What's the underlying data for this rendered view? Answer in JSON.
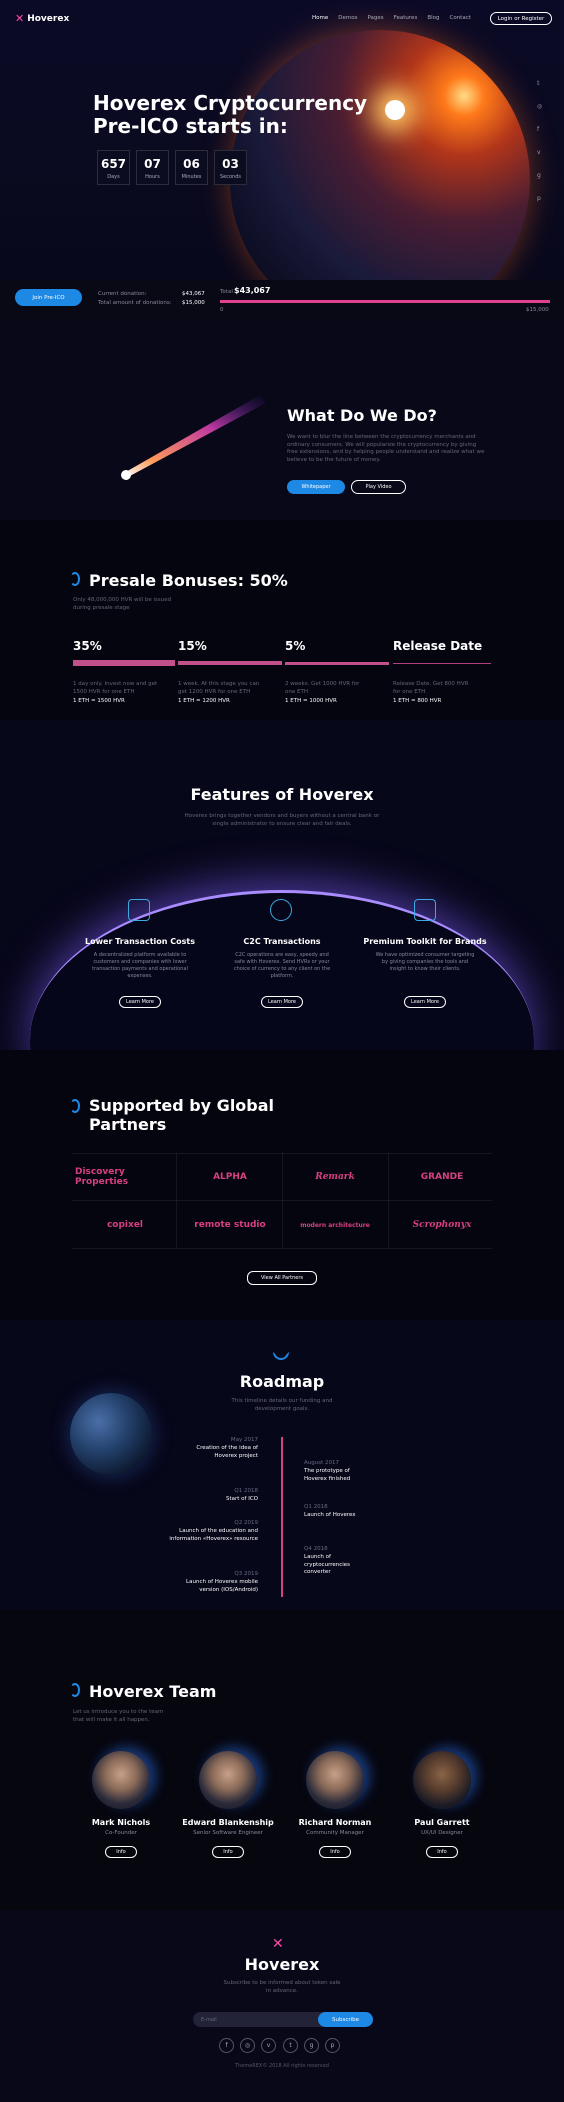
{
  "header": {
    "logo": "Hoverex",
    "nav": [
      "Home",
      "Demos",
      "Pages",
      "Features",
      "Blog",
      "Contact"
    ],
    "login": "Login or Register"
  },
  "hero": {
    "title": "Hoverex Cryptocurrency Pre-ICO starts in:",
    "countdown": [
      {
        "value": "657",
        "label": "Days"
      },
      {
        "value": "07",
        "label": "Hours"
      },
      {
        "value": "06",
        "label": "Minutes"
      },
      {
        "value": "03",
        "label": "Seconds"
      }
    ],
    "social_icons": [
      "twitter-icon",
      "instagram-icon",
      "facebook-icon",
      "vk-icon",
      "google-plus-icon",
      "pinterest-icon"
    ]
  },
  "ico": {
    "join": "Join Pre-ICO",
    "current_label": "Current donation:",
    "current_value": "$43,067",
    "total_label": "Total amount of donations:",
    "total_value": "$15,000",
    "raised_prefix": "Total",
    "raised": "$43,067",
    "bar_min": "0",
    "bar_max": "$15,000",
    "progress": 1.0
  },
  "what": {
    "title": "What Do We Do?",
    "text": "We want to blur the line between the cryptocurrency merchants and ordinary consumers. We will popularize the cryptocurrency by giving free extensions, and by helping people understand and realize what we believe to be the future of money.",
    "btn1": "Whitepaper",
    "btn2": "Play Video"
  },
  "presale": {
    "title": "Presale Bonuses: 50%",
    "subtitle": "Only 48,000,000 HVR will be issued during presale stage",
    "stages": [
      {
        "pct": "35%",
        "desc": "1 day only. Invest now and get 1500 HVR for one ETH",
        "rate": "1 ETH = 1500 HVR"
      },
      {
        "pct": "15%",
        "desc": "1 week. At this stage you can get 1200 HVR for one ETH",
        "rate": "1 ETH = 1200 HVR"
      },
      {
        "pct": "5%",
        "desc": "2 weeks. Get 1000 HVR for one ETH",
        "rate": "1 ETH = 1000 HVR"
      },
      {
        "pct": "Release Date",
        "desc": "Release Date. Get 800 HVR for one ETH",
        "rate": "1 ETH = 800 HVR"
      }
    ]
  },
  "features": {
    "title": "Features of Hoverex",
    "subtitle": "Hoverex brings together vendors and buyers without a central bank or single administrator to ensure clear and fair deals.",
    "items": [
      {
        "title": "Lower Transaction Costs",
        "text": "A decentralized platform available to customers and companies with lower transaction payments and operational expenses.",
        "btn": "Learn More"
      },
      {
        "title": "C2C Transactions",
        "text": "C2C operations are easy, speedy and safe with Hoverex. Send HVRs or your choice of currency to any client on the platform.",
        "btn": "Learn More"
      },
      {
        "title": "Premium Toolkit for Brands",
        "text": "We have optimized consumer targeting by giving companies the tools and insight to know their clients.",
        "btn": "Learn More"
      }
    ]
  },
  "partners": {
    "title": "Supported by Global Partners",
    "logos": [
      "Discovery Properties",
      "ALPHA",
      "Remark",
      "GRANDE",
      "copixel",
      "remote studio",
      "modern architecture",
      "Scrophonyx"
    ],
    "btn": "View All Partners"
  },
  "roadmap": {
    "title": "Roadmap",
    "subtitle": "This timeline details our funding and development goals.",
    "left": [
      {
        "date": "May 2017",
        "text": "Creation of the idea of Hoverex project"
      },
      {
        "date": "Q1 2018",
        "text": "Start of ICO"
      },
      {
        "date": "Q2 2019",
        "text": "Launch of the education and information «Hoverex» resource"
      },
      {
        "date": "Q3 2019",
        "text": "Launch of Hoverex mobile version (IOS/Android)"
      }
    ],
    "right": [
      {
        "date": "August 2017",
        "text": "The prototype of Hoverex finished"
      },
      {
        "date": "Q1 2018",
        "text": "Launch of Hoverex"
      },
      {
        "date": "Q4 2018",
        "text": "Launch of cryptocurrencies converter"
      }
    ]
  },
  "team": {
    "title": "Hoverex Team",
    "subtitle": "Let us introduce you to the team that will make it all happen.",
    "members": [
      {
        "name": "Mark Nichols",
        "role": "Co-Founder",
        "btn": "Info"
      },
      {
        "name": "Edward Blankenship",
        "role": "Senior Software Engineer",
        "btn": "Info"
      },
      {
        "name": "Richard Norman",
        "role": "Community Manager",
        "btn": "Info"
      },
      {
        "name": "Paul Garrett",
        "role": "UX/UI Designer",
        "btn": "Info"
      }
    ]
  },
  "footer": {
    "logo": "Hoverex",
    "subtitle": "Subscribe to be informed about token sale in advance.",
    "email_placeholder": "E-mail",
    "subscribe": "Subscribe",
    "icons": [
      "facebook-icon",
      "instagram-icon",
      "vk-icon",
      "twitter-icon",
      "google-plus-icon",
      "pinterest-icon"
    ],
    "copyright": "ThemeREX© 2018 All rights reserved"
  },
  "colors": {
    "accent": "#1e88e5",
    "pink": "#e0428f"
  }
}
